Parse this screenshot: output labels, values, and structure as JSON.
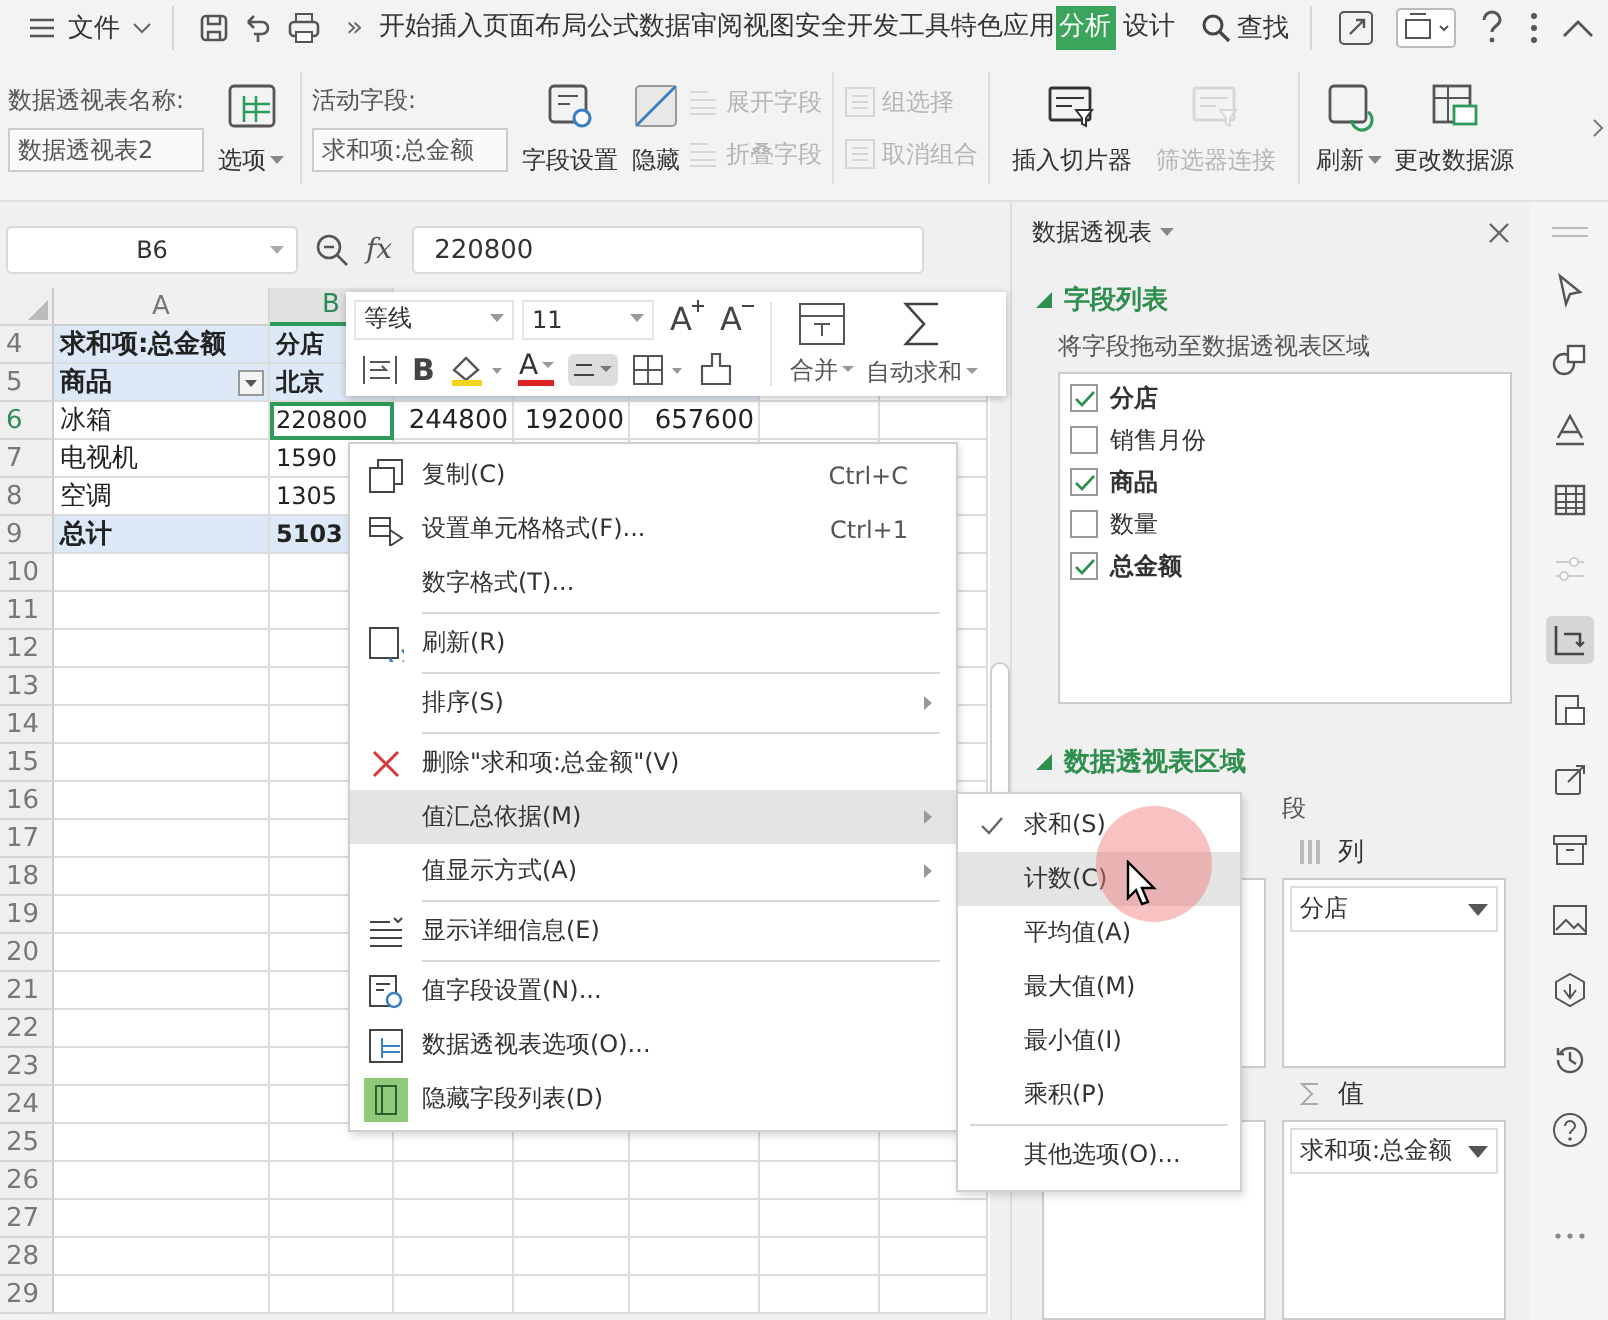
{
  "title_bar": {
    "menu_label": "文件",
    "more": "»",
    "search": "查找",
    "tabs": [
      {
        "label": "开始",
        "selected": false
      },
      {
        "label": "插入",
        "selected": false
      },
      {
        "label": "页面布局",
        "selected": false
      },
      {
        "label": "公式",
        "selected": false
      },
      {
        "label": "数据",
        "selected": false
      },
      {
        "label": "审阅",
        "selected": false
      },
      {
        "label": "视图",
        "selected": false
      },
      {
        "label": "安全",
        "selected": false
      },
      {
        "label": "开发工具",
        "selected": false
      },
      {
        "label": "特色应用",
        "selected": false
      },
      {
        "label": "分析",
        "selected": true
      },
      {
        "label": "设计",
        "selected": false
      }
    ]
  },
  "ribbon": {
    "pivot_name": {
      "label": "数据透视表名称:",
      "value": "数据透视表2"
    },
    "options_button": "选项",
    "active_field": {
      "label": "活动字段:",
      "value": "求和项:总金额"
    },
    "buttons": [
      {
        "label": "字段设置",
        "disabled": false
      },
      {
        "label": "隐藏",
        "disabled": false
      },
      {
        "label": "展开字段",
        "disabled": true
      },
      {
        "label": "折叠字段",
        "disabled": true
      },
      {
        "label": "组选择",
        "disabled": true
      },
      {
        "label": "取消组合",
        "disabled": true
      },
      {
        "label": "插入切片器",
        "disabled": false
      },
      {
        "label": "筛选器连接",
        "disabled": true
      },
      {
        "label": "刷新",
        "disabled": false
      },
      {
        "label": "更改数据源",
        "disabled": false
      }
    ]
  },
  "formula_bar": {
    "cell_ref": "B6",
    "fx_label": "fx",
    "value": "220800"
  },
  "sheet": {
    "columns": [
      {
        "label": "A",
        "selected": false
      },
      {
        "label": "B",
        "selected": true
      }
    ],
    "rows": [
      {
        "number": "4",
        "kind": "header",
        "selected": false,
        "filter": false,
        "cells": [
          "求和项:总金额",
          "分店"
        ]
      },
      {
        "number": "5",
        "kind": "header",
        "selected": false,
        "filter": true,
        "cells": [
          "商品",
          "北京"
        ]
      },
      {
        "number": "6",
        "kind": "data",
        "selected": true,
        "filter": false,
        "cells": [
          "冰箱",
          "220800",
          "244800",
          "192000",
          "657600"
        ]
      },
      {
        "number": "7",
        "kind": "data",
        "selected": false,
        "filter": false,
        "cells": [
          "电视机",
          "1590"
        ]
      },
      {
        "number": "8",
        "kind": "data",
        "selected": false,
        "filter": false,
        "cells": [
          "空调",
          "1305"
        ]
      },
      {
        "number": "9",
        "kind": "total",
        "selected": false,
        "filter": false,
        "cells": [
          "总计",
          "5103"
        ]
      }
    ],
    "empty_rows": [
      "10",
      "11",
      "12",
      "13",
      "14",
      "15",
      "16",
      "17",
      "18",
      "19",
      "20",
      "21",
      "22",
      "23",
      "24",
      "25",
      "26",
      "27",
      "28",
      "29"
    ]
  },
  "mini_toolbar": {
    "font": "等线",
    "size": "11",
    "grow": "A",
    "shrink": "A",
    "bold": "B",
    "color_letter": "A",
    "merge": "合并",
    "autosum": "自动求和"
  },
  "context_menu": [
    {
      "label": "复制(C)",
      "shortcut": "Ctrl+C",
      "divider": false,
      "submenu": false,
      "highlighted": false
    },
    {
      "label": "设置单元格格式(F)...",
      "shortcut": "Ctrl+1",
      "divider": false,
      "submenu": false,
      "highlighted": false
    },
    {
      "label": "数字格式(T)...",
      "divider": false,
      "submenu": false,
      "highlighted": false
    },
    {
      "label": "刷新(R)",
      "divider": true,
      "submenu": false,
      "highlighted": false
    },
    {
      "label": "排序(S)",
      "divider": true,
      "submenu": true,
      "highlighted": false
    },
    {
      "label": "删除\"求和项:总金额\"(V)",
      "divider": true,
      "submenu": false,
      "highlighted": false
    },
    {
      "label": "值汇总依据(M)",
      "divider": false,
      "submenu": true,
      "highlighted": true
    },
    {
      "label": "值显示方式(A)",
      "divider": false,
      "submenu": true,
      "highlighted": false
    },
    {
      "label": "显示详细信息(E)",
      "divider": true,
      "submenu": false,
      "highlighted": false
    },
    {
      "label": "值字段设置(N)...",
      "divider": true,
      "submenu": false,
      "highlighted": false
    },
    {
      "label": "数据透视表选项(O)...",
      "divider": false,
      "submenu": false,
      "highlighted": false
    },
    {
      "label": "隐藏字段列表(D)",
      "divider": false,
      "submenu": false,
      "highlighted": false
    }
  ],
  "submenu": [
    {
      "label": "求和(S)",
      "checked": true,
      "highlighted": false,
      "divider": false
    },
    {
      "label": "计数(C)",
      "checked": false,
      "highlighted": true,
      "divider": false
    },
    {
      "label": "平均值(A)",
      "checked": false,
      "highlighted": false,
      "divider": false
    },
    {
      "label": "最大值(M)",
      "checked": false,
      "highlighted": false,
      "divider": false
    },
    {
      "label": "最小值(I)",
      "checked": false,
      "highlighted": false,
      "divider": false
    },
    {
      "label": "乘积(P)",
      "checked": false,
      "highlighted": false,
      "divider": false
    },
    {
      "label": "其他选项(O)...",
      "checked": false,
      "highlighted": false,
      "divider": true
    }
  ],
  "panel": {
    "title": "数据透视表",
    "field_list": {
      "heading": "字段列表",
      "hint": "将字段拖动至数据透视表区域",
      "fields": [
        {
          "label": "分店",
          "checked": true
        },
        {
          "label": "销售月份",
          "checked": false
        },
        {
          "label": "商品",
          "checked": true
        },
        {
          "label": "数量",
          "checked": false
        },
        {
          "label": "总金额",
          "checked": true
        }
      ]
    },
    "areas": {
      "heading": "数据透视表区域",
      "hint": "段",
      "columns": {
        "label": "列",
        "items": [
          "分店"
        ]
      },
      "values": {
        "label": "值",
        "items": [
          "求和项:总金额"
        ]
      }
    }
  }
}
